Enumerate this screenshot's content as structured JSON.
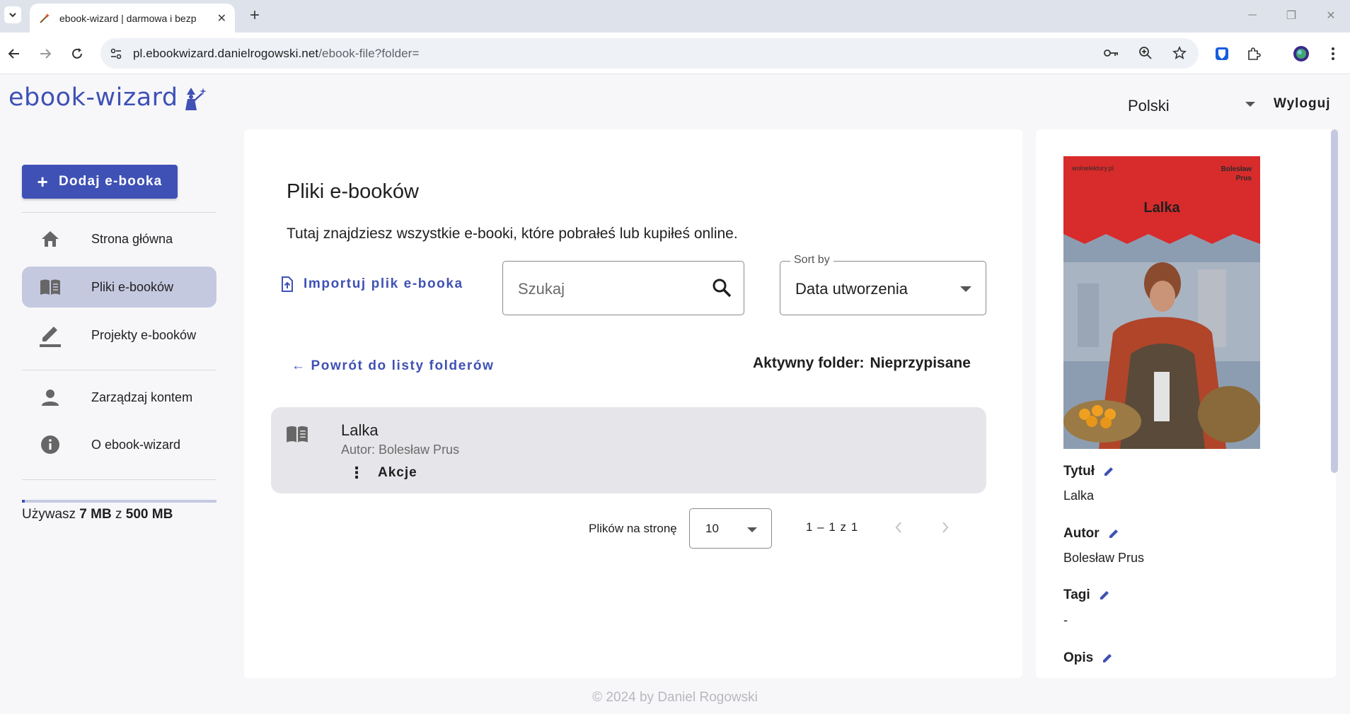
{
  "browser": {
    "tab_title": "ebook-wizard | darmowa i bezp",
    "url_host": "pl.ebookwizard.danielrogowski.net",
    "url_path": "/ebook-file?folder="
  },
  "header": {
    "logo_text": "ebook-wizard",
    "language": "Polski",
    "logout_label": "Wyloguj"
  },
  "sidebar": {
    "add_button_label": "Dodaj e-booka",
    "items": [
      {
        "label": "Strona główna",
        "icon": "home-icon"
      },
      {
        "label": "Pliki e-booków",
        "icon": "book-icon",
        "active": true
      },
      {
        "label": "Projekty e-booków",
        "icon": "edit-icon"
      },
      {
        "label": "Zarządzaj kontem",
        "icon": "person-icon"
      },
      {
        "label": "O ebook-wizard",
        "icon": "info-icon"
      }
    ],
    "usage": {
      "prefix": "Używasz",
      "used": "7 MB",
      "sep": "z",
      "total": "500 MB",
      "fraction": 0.014
    }
  },
  "main": {
    "title": "Pliki e-booków",
    "description": "Tutaj znajdziesz wszystkie e-booki, które pobrałeś lub kupiłeś online.",
    "import_label": "Importuj plik e-booka",
    "search_placeholder": "Szukaj",
    "sort_label": "Sort by",
    "sort_value": "Data utworzenia",
    "back_label": "← Powrót do listy folderów",
    "active_folder_label": "Aktywny folder:",
    "active_folder_value": "Nieprzypisane",
    "files": [
      {
        "title": "Lalka",
        "author": "Autor: Bolesław Prus",
        "actions_label": "Akcje"
      }
    ],
    "pager": {
      "label": "Plików na stronę",
      "page_size": "10",
      "range": "1 – 1 z 1"
    }
  },
  "details": {
    "cover": {
      "brand": "wolnelektury.pl",
      "author_line1": "Bolesław",
      "author_line2": "Prus",
      "title": "Lalka"
    },
    "fields": [
      {
        "label": "Tytuł",
        "value": "Lalka"
      },
      {
        "label": "Autor",
        "value": "Bolesław Prus"
      },
      {
        "label": "Tagi",
        "value": "-"
      },
      {
        "label": "Opis",
        "value": ""
      }
    ]
  },
  "footer": "© 2024 by Daniel Rogowski",
  "colors": {
    "accent": "#3f51b5",
    "active_nav": "#c5c9e0",
    "background": "#f7f7fa"
  }
}
